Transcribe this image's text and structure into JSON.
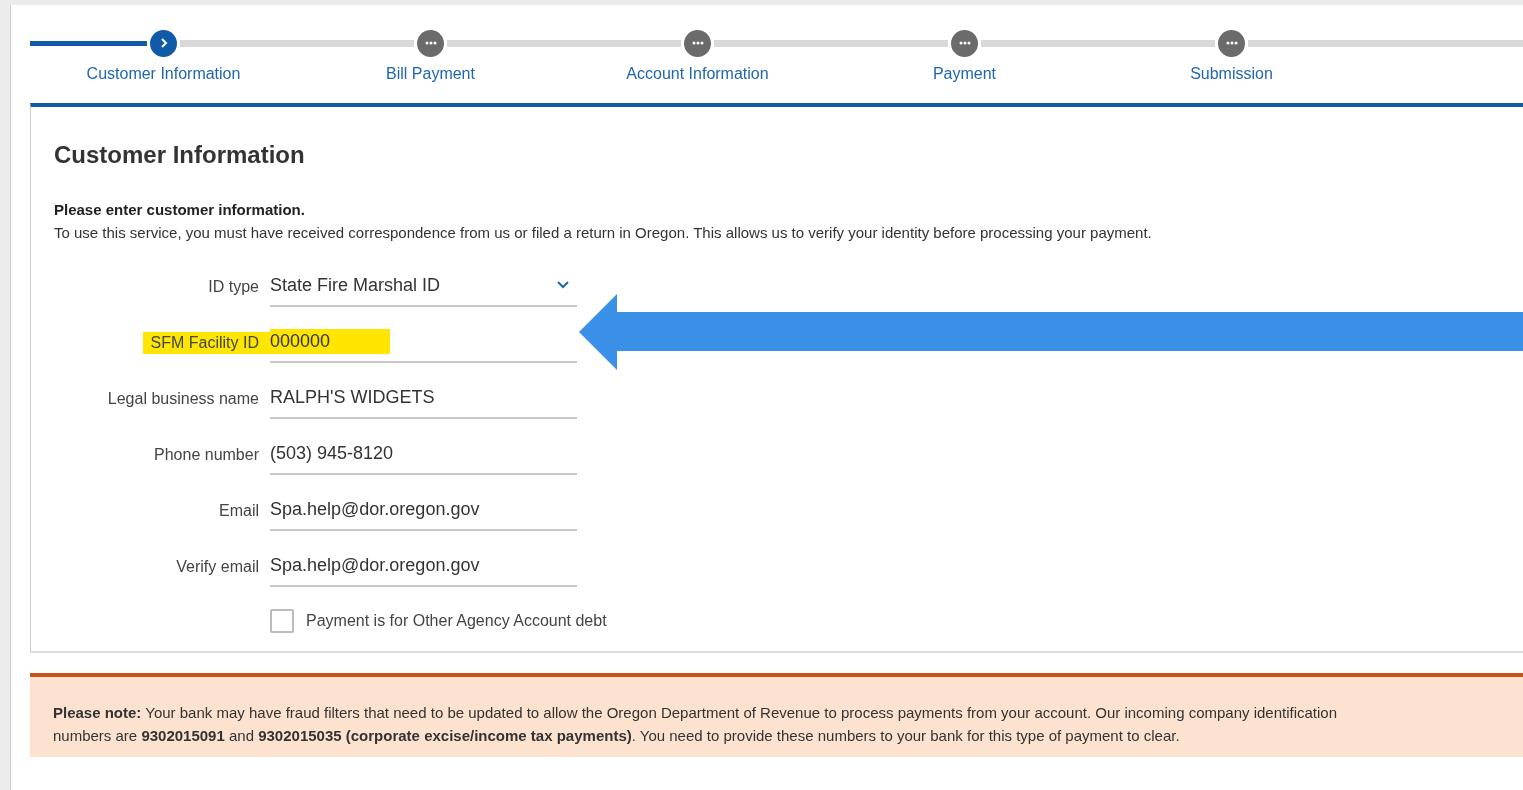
{
  "steps": [
    {
      "label": "Customer Information",
      "selected": true
    },
    {
      "label": "Bill Payment",
      "selected": false
    },
    {
      "label": "Account Information",
      "selected": false
    },
    {
      "label": "Payment",
      "selected": false
    },
    {
      "label": "Submission",
      "selected": false
    }
  ],
  "section": {
    "title": "Customer Information",
    "intro": "Please enter customer information.",
    "description": "To use this service, you must have received correspondence from us or filed a return in Oregon. This allows us to verify your identity before processing your payment."
  },
  "fields": [
    {
      "label": "ID type",
      "value": "State Fire Marshal ID",
      "kind": "select",
      "highlighted": false
    },
    {
      "label": "SFM Facility ID",
      "value": "000000",
      "kind": "text",
      "highlighted": true
    },
    {
      "label": "Legal business name",
      "value": "RALPH'S WIDGETS",
      "kind": "text",
      "highlighted": false
    },
    {
      "label": "Phone number",
      "value": "(503) 945-8120",
      "kind": "text",
      "highlighted": false
    },
    {
      "label": "Email",
      "value": "Spa.help@dor.oregon.gov",
      "kind": "text",
      "highlighted": false
    },
    {
      "label": "Verify email",
      "value": "Spa.help@dor.oregon.gov",
      "kind": "text",
      "highlighted": false
    }
  ],
  "checkbox": {
    "label": "Payment is for Other Agency Account debt",
    "checked": false
  },
  "note": {
    "text": "**Please note:** Your bank may have fraud filters that need to be updated to allow the Oregon Department of Revenue to process payments from your account. Our incoming company identification numbers are **9302015091** and **9302015035 (corporate excise/income tax payments)**. You need to provide these numbers to your bank for this type of payment to clear."
  }
}
